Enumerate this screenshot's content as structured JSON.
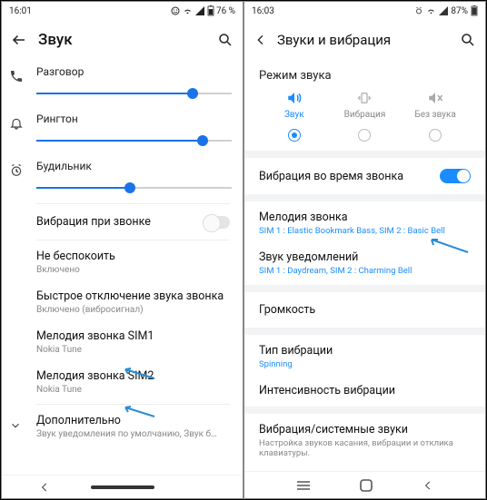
{
  "left": {
    "time": "16:01",
    "battery": "76 %",
    "title": "Звук",
    "sliders": {
      "talk": {
        "label": "Разговор",
        "value": 80
      },
      "ring": {
        "label": "Рингтон",
        "value": 85
      },
      "alarm": {
        "label": "Будильник",
        "value": 48
      }
    },
    "vibrate": {
      "label": "Вибрация при звонке",
      "on": false
    },
    "items": {
      "dnd": {
        "title": "Не беспокоить",
        "sub": "Включено"
      },
      "quick": {
        "title": "Быстрое отключение звука звонка",
        "sub": "Включено (вибросигнал)"
      },
      "sim1": {
        "title": "Мелодия звонка SIM1",
        "sub": "Nokia Tune"
      },
      "sim2": {
        "title": "Мелодия звонка SIM2",
        "sub": "Nokia Tune"
      },
      "adv": {
        "title": "Дополнительно",
        "sub": "Звук уведомления по умолчанию, Звук буди..."
      }
    }
  },
  "right": {
    "time": "16:03",
    "battery": "87%",
    "title": "Звуки и вибрация",
    "mode_title": "Режим звука",
    "modes": {
      "sound": "Звук",
      "vibrate": "Вибрация",
      "silent": "Без звука"
    },
    "rows": {
      "vibrate_ring": {
        "title": "Вибрация во время звонка",
        "on": true
      },
      "ringtone": {
        "title": "Мелодия звонка",
        "sub": "SIM 1 : Elastic Bookmark Bass, SIM 2 : Basic Bell"
      },
      "notif": {
        "title": "Звук уведомлений",
        "sub": "SIM 1 : Daydream, SIM 2 : Charming Bell"
      },
      "volume": {
        "title": "Громкость"
      },
      "vib_type": {
        "title": "Тип вибрации",
        "sub": "Spinning"
      },
      "vib_int": {
        "title": "Интенсивность вибрации"
      },
      "sys": {
        "title": "Вибрация/системные звуки",
        "sub": "Настройка звуков касания, вибрации и отклика клавиатуры."
      }
    }
  }
}
